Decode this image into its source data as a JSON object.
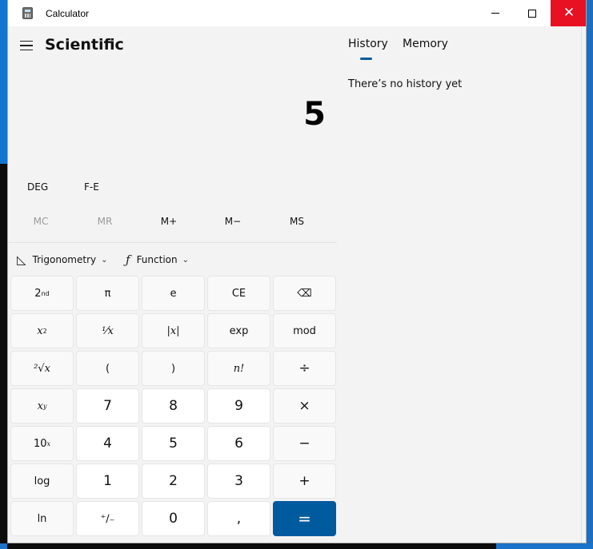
{
  "window": {
    "title": "Calculator",
    "close_glyph": "✕"
  },
  "header": {
    "mode": "Scientific"
  },
  "display": {
    "value": "5"
  },
  "toggles": {
    "angle_unit": "DEG",
    "fe": "F-E"
  },
  "memory_row": [
    {
      "label": "MC",
      "enabled": false
    },
    {
      "label": "MR",
      "enabled": false
    },
    {
      "label": "M+",
      "enabled": true
    },
    {
      "label": "M−",
      "enabled": true
    },
    {
      "label": "MS",
      "enabled": true
    }
  ],
  "dropdowns": {
    "trig_label": "Trigonometry",
    "func_label": "Function",
    "func_icon": "ƒ",
    "trig_icon": "◺",
    "chevron": "⌄"
  },
  "keys": {
    "second": "2",
    "second_sup": "nd",
    "pi": "π",
    "e": "e",
    "ce": "CE",
    "backspace": "⌫",
    "x_squared": "x",
    "x_squared_sup": "2",
    "reciprocal": "¹⁄x",
    "abs": "|x|",
    "exp": "exp",
    "mod": "mod",
    "sqrt": "²√x",
    "lparen": "(",
    "rparen": ")",
    "factorial": "n!",
    "divide": "÷",
    "x_pow_y": "x",
    "x_pow_y_sup": "y",
    "seven": "7",
    "eight": "8",
    "nine": "9",
    "multiply": "×",
    "ten_pow_x": "10",
    "ten_pow_x_sup": "x",
    "four": "4",
    "five": "5",
    "six": "6",
    "minus": "−",
    "log": "log",
    "one": "1",
    "two": "2",
    "three": "3",
    "plus": "+",
    "ln": "ln",
    "negate": "⁺∕₋",
    "zero": "0",
    "decimal": ",",
    "equals": "="
  },
  "side_panel": {
    "tabs": [
      "History",
      "Memory"
    ],
    "active_tab": "History",
    "empty_message": "There’s no history yet"
  },
  "colors": {
    "accent": "#005a9e",
    "close_red": "#e81123",
    "window_bg": "#f3f3f3"
  }
}
